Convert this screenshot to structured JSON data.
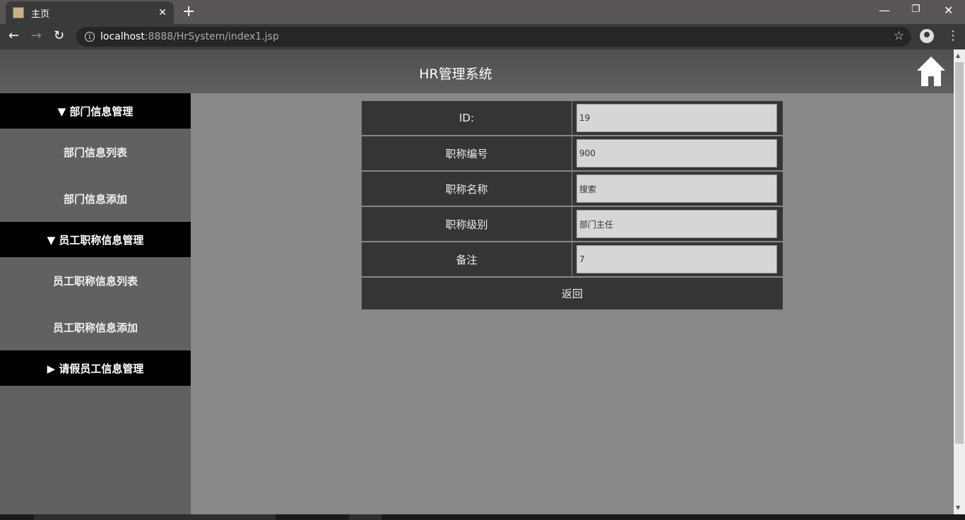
{
  "browser": {
    "tab_title": "主页",
    "url_host": "localhost",
    "url_rest": ":8888/HrSystem/index1.jsp"
  },
  "header": {
    "title": "HR管理系统"
  },
  "sidebar": {
    "sections": [
      {
        "label": "▼ 部门信息管理",
        "items": [
          "部门信息列表",
          "部门信息添加"
        ]
      },
      {
        "label": "▼ 员工职称信息管理",
        "items": [
          "员工职称信息列表",
          "员工职称信息添加"
        ]
      },
      {
        "label": "▶ 请假员工信息管理",
        "items": []
      }
    ]
  },
  "form": {
    "rows": [
      {
        "label": "ID:",
        "value": "19"
      },
      {
        "label": "职称编号",
        "value": "900"
      },
      {
        "label": "职称名称",
        "value": "搜索"
      },
      {
        "label": "职称级别",
        "value": "部门主任"
      },
      {
        "label": "备注",
        "value": "7"
      }
    ],
    "back_label": "返回"
  },
  "colors": {
    "header_bg": "#555555",
    "sidebar_bg": "#616161",
    "section_bg": "#000000",
    "content_bg": "#888888",
    "form_cell_bg": "#353535",
    "input_bg": "#d6d6d6"
  }
}
